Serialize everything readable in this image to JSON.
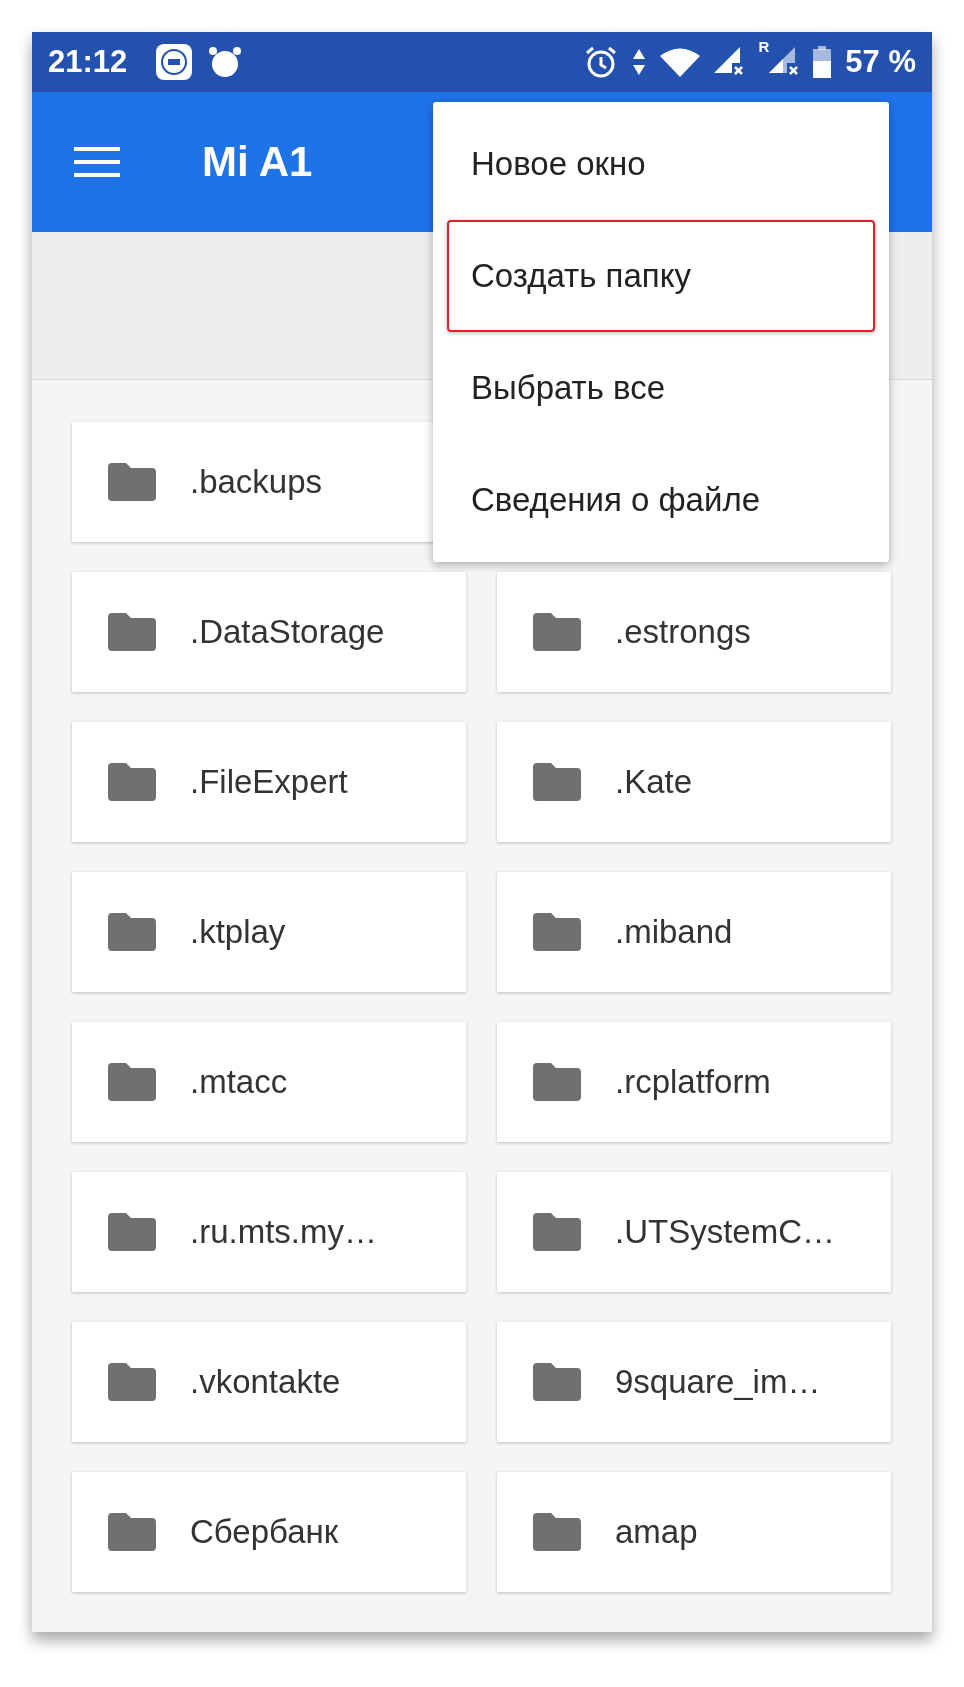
{
  "status_bar": {
    "time": "21:12",
    "roaming": "R",
    "battery": "57 %"
  },
  "app_bar": {
    "title": "Mi A1"
  },
  "folder_rows": [
    [
      ".backups"
    ],
    [
      ".DataStorage",
      ".estrongs"
    ],
    [
      ".FileExpert",
      ".Kate"
    ],
    [
      ".ktplay",
      ".miband"
    ],
    [
      ".mtacc",
      ".rcplatform"
    ],
    [
      ".ru.mts.my…",
      ".UTSystemC…"
    ],
    [
      ".vkontakte",
      "9square_im…"
    ],
    [
      "Сбербанк",
      "amap"
    ]
  ],
  "menu": {
    "items": [
      {
        "label": "Новое окно",
        "highlighted": false
      },
      {
        "label": "Создать папку",
        "highlighted": true
      },
      {
        "label": "Выбрать все",
        "highlighted": false
      },
      {
        "label": "Сведения о файле",
        "highlighted": false
      }
    ]
  }
}
